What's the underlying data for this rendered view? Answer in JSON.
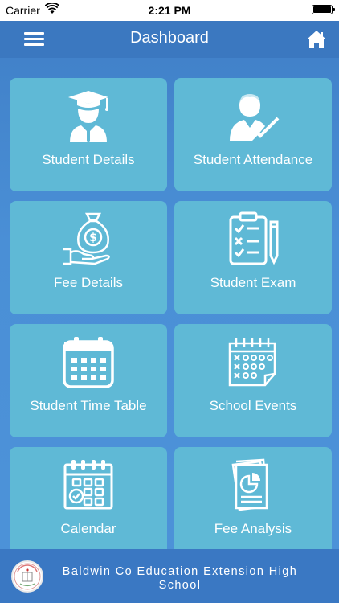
{
  "status_bar": {
    "carrier": "Carrier",
    "time": "2:21 PM"
  },
  "navbar": {
    "title": "Dashboard",
    "menu_icon": "hamburger-icon",
    "home_icon": "home-icon"
  },
  "tiles": [
    {
      "label": "Student Details",
      "icon": "graduate-icon"
    },
    {
      "label": "Student Attendance",
      "icon": "attendance-icon"
    },
    {
      "label": "Fee Details",
      "icon": "money-bag-icon"
    },
    {
      "label": "Student Exam",
      "icon": "exam-clipboard-icon"
    },
    {
      "label": "Student Time Table",
      "icon": "calendar-grid-icon"
    },
    {
      "label": "School Events",
      "icon": "events-calendar-icon"
    },
    {
      "label": "Calendar",
      "icon": "calendar-check-icon"
    },
    {
      "label": "Fee Analysis",
      "icon": "report-chart-icon"
    }
  ],
  "footer": {
    "school_name": "Baldwin Co Education Extension High School"
  },
  "colors": {
    "background": "#4a8fd6",
    "navbar": "#3b78c0",
    "tile": "#5fb9d6",
    "text": "#ffffff"
  }
}
